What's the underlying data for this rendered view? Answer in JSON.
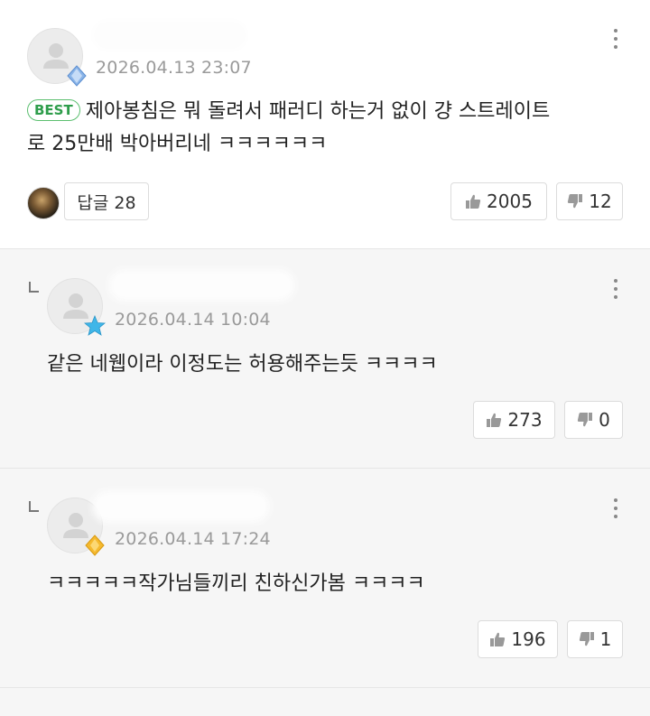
{
  "comments": [
    {
      "date": "2026.04.13 23:07",
      "best_label": "BEST",
      "text_line1": "제아봉침은 뭐 돌려서 패러디 하는거 없이 걍 스트레이트",
      "text_line2": "로 25만배 박아버리네 ㅋㅋㅋㅋㅋㅋ",
      "reply_label": "답글 28",
      "likes": "2005",
      "dislikes": "12",
      "badge_color": "#8ab4e8"
    },
    {
      "date": "2026.04.14 10:04",
      "text": "같은 네웹이라 이정도는 허용해주는듯 ㅋㅋㅋㅋ",
      "likes": "273",
      "dislikes": "0",
      "badge_color": "#3fb6e8"
    },
    {
      "date": "2026.04.14 17:24",
      "text": "ㅋㅋㅋㅋㅋ작가님들끼리 친하신가봄 ㅋㅋㅋㅋ",
      "likes": "196",
      "dislikes": "1",
      "badge_color": "#f5b92e"
    }
  ]
}
